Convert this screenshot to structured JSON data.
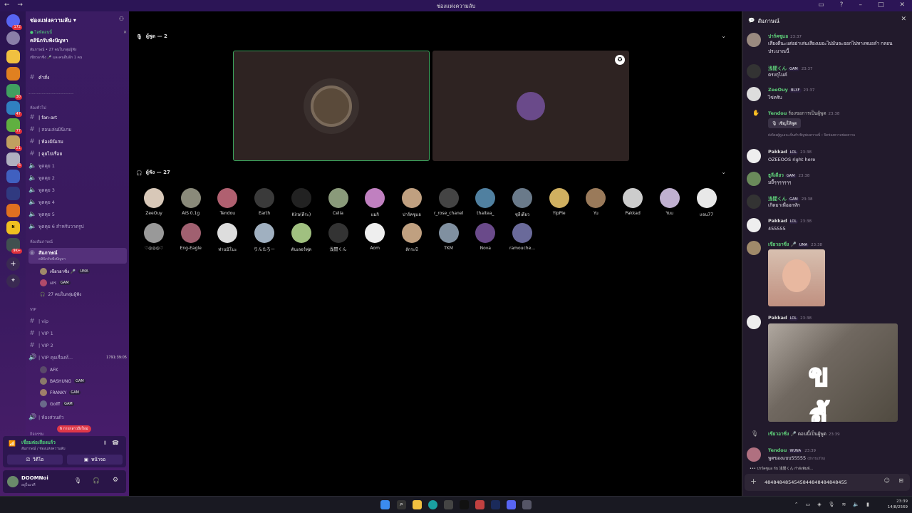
{
  "window": {
    "title": "ช่องแห่งความลับ",
    "nav": "← →"
  },
  "server": {
    "name": "ช่องแห่งความลับ ▾"
  },
  "event": {
    "tag": "● ไลฟ์ตอนนี้",
    "title": "คลินิกรับฟังปัญหา",
    "line1": "สัมภาษณ์ • 27 คนในกลุ่มผู้ฟัง",
    "line2": "เขียวอาซิ่ง 🎤 และคนอื่นอีก 1 คน"
  },
  "channels": {
    "commands": "คำสั่ง",
    "divider": "---------------------------",
    "cat_general": "ห้องทั่วไป",
    "general": [
      "| fan-art",
      "| สอนเล่นมินิเกม",
      "| ห้องมินิเกม",
      "| คุยไปเรื่อย",
      "พูดคุย 1",
      "พูดคุย 2",
      "พูดคุย 3",
      "พูดคุย 4",
      "พูดคุย 5",
      "พูดคุย 6 สำหรับวาดรูป"
    ],
    "cat_stage": "ห้องสัมภาษณ์",
    "stage_name": "สัมภาษณ์",
    "stage_sub": "คลินิกรับฟังปัญหา",
    "stage_users": [
      {
        "name": "เขียวอาซิ่ง 🎤",
        "tag": "UMA"
      },
      {
        "name": "เสร",
        "tag": "GAM"
      }
    ],
    "stage_listeners": "27 คนในกลุ่มผู้ฟัง",
    "cat_vip": "VIP",
    "vip": [
      "| vip",
      "| VIP 1",
      "| VIP 2",
      "| VIP คุยเรื่องทั่..."
    ],
    "vip_timer": "1791:39:05",
    "vip_users": [
      {
        "name": "AFK",
        "tag": ""
      },
      {
        "name": "BASHUNG",
        "tag": "GAM"
      },
      {
        "name": "FRANKY",
        "tag": "GAM"
      },
      {
        "name": "Golff",
        "tag": "GAM"
      }
    ],
    "private": "| ห้องส่วนตัว",
    "mentions": "6 การกล่าวถึงใหม่",
    "cat_bottom": "กิจกรรม"
  },
  "voice": {
    "status": "เชื่อมต่อเสียงแล้ว",
    "sub": "สัมภาษณ์ / ช่องแห่งความลับ",
    "video": "วิดีโอ",
    "screen": "หน้าจอ"
  },
  "user": {
    "name": "DOOMNoi",
    "status": "อยู่ในเวที"
  },
  "stage": {
    "speakers_label": "ผู้พูด — 2",
    "audience_label": "ผู้ฟัง — 27",
    "audience": [
      "ZeeOuy",
      "AIS 0.1g",
      "Tendou",
      "Earth",
      "Kira(ดีระ)",
      "Celia",
      "แมกิ",
      "ปาร์คซูแอ",
      "r_rose_chanel",
      "thaitea_",
      "ชุลีเดียว",
      "YipPie",
      "Yu",
      "Pakkad",
      "Yuu",
      "แจน77",
      "♡◎◎◎♡",
      "Eng-Eagle",
      "ท่านนิโนะ",
      "りんたろー",
      "ตันเลอร์ฟุด",
      "浅閒くん",
      "Aom",
      "ลักระบี",
      "TKM",
      "Nova",
      "ramouche..."
    ]
  },
  "chat": {
    "title": "สัมภาษณ์",
    "messages": [
      {
        "name": "ปาร์คซูแอ",
        "time": "23:37",
        "text": "เสียงดีนะแต่อย่าเล่นเสียงเยอะไปมันจะออกไปทางหมอลำ กลอน ประมาณนี้",
        "color": "#5fd07a"
      },
      {
        "name": "浅閒くん",
        "tag": "GAM",
        "time": "23:37",
        "text": "ตรงกุไมค์",
        "color": "#5fd07a"
      },
      {
        "name": "ZeeOuy",
        "tag": "BLXF",
        "time": "23:37",
        "text": "ไข่ครับ",
        "color": "#5fd07a"
      },
      {
        "name": "Tendou",
        "time": "23:38",
        "text": "ร้องขอการเป็นผู้พูด",
        "color": "#5fd07a"
      },
      {
        "name": "Pakkad",
        "tag": "LOL",
        "time": "23:38",
        "text": "OZEEOOS right here",
        "color": "#dddddd"
      },
      {
        "name": "ธูลีเดียว",
        "tag": "GAM",
        "time": "23:38",
        "text": "มยี้ๆๆๆๆๆๆๆ",
        "color": "#5fd07a"
      },
      {
        "name": "浅閒くん",
        "tag": "GAM",
        "time": "23:38",
        "text": "เกิดมาเพื่ออกหัก",
        "color": "#5fd07a"
      },
      {
        "name": "Pakkad",
        "tag": "LOL",
        "time": "23:38",
        "text": "455555",
        "color": "#dddddd"
      },
      {
        "name": "เขียวอาซิ่ง 🎤",
        "tag": "UMA",
        "time": "23:38",
        "text": "",
        "color": "#5fd07a"
      },
      {
        "name": "Pakkad",
        "tag": "LOL",
        "time": "23:38",
        "text": "",
        "color": "#dddddd"
      },
      {
        "name": "เขียวอาซิ่ง 🎤",
        "time": "23:39",
        "text": "ตอนนี้เป็นผู้พูด",
        "color": "#5fd07a"
      },
      {
        "name": "Tendou",
        "tag": "WUNA",
        "time": "23:39",
        "text": "พูดของแบบ55555",
        "color": "#5fd07a"
      }
    ],
    "invite_btn": "เชิญให้พูด",
    "invite_note": "ยังพิจอผู้ดูแลจะเห็นคำเชิญช่องความนี้ • ปิดช่องความช่องความ",
    "edited": "(มีการแก้ไข)",
    "typing": "ปาร์คซูแอ กับ 浅閒くん กำลังพิมพ์...",
    "meme_text": "ข ยี้",
    "composer_value": "4848484854545844848484848455"
  },
  "guild_badges": [
    "172",
    "30",
    "47",
    "77",
    "21",
    "6",
    "9K+"
  ],
  "clock": {
    "time": "23:39",
    "date": "14/8/2569"
  }
}
